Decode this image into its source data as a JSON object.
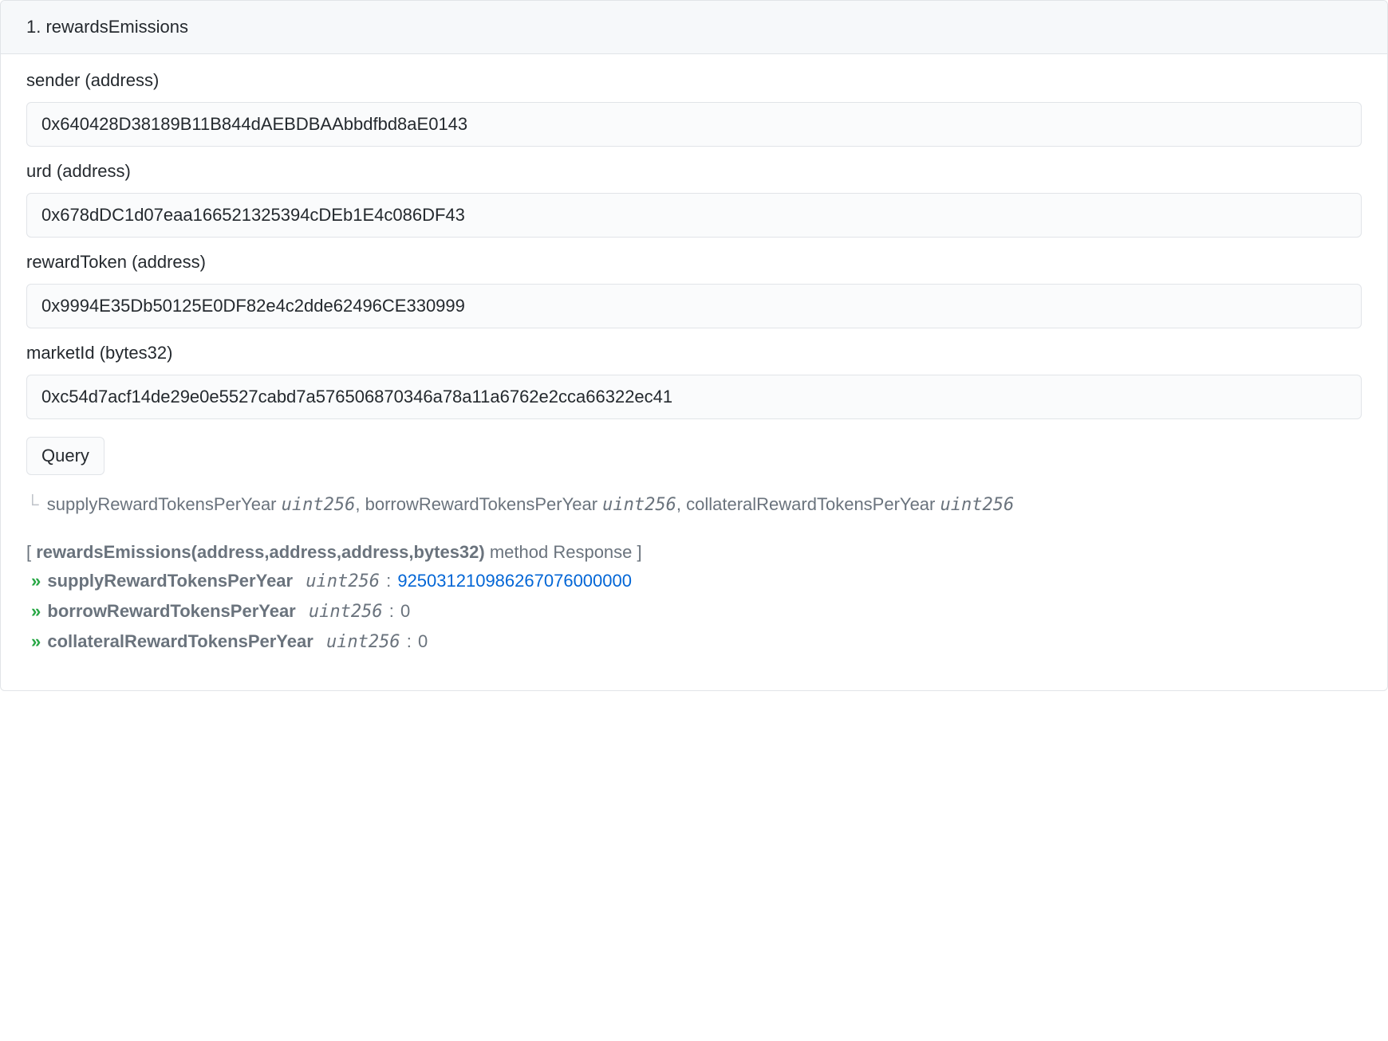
{
  "panel": {
    "header": "1. rewardsEmissions",
    "fields": [
      {
        "label": "sender (address)",
        "value": "0x640428D38189B11B844dAEBDBAAbbdfbd8aE0143"
      },
      {
        "label": "urd (address)",
        "value": "0x678dDC1d07eaa166521325394cDEb1E4c086DF43"
      },
      {
        "label": "rewardToken (address)",
        "value": "0x9994E35Db50125E0DF82e4c2dde62496CE330999"
      },
      {
        "label": "marketId (bytes32)",
        "value": "0xc54d7acf14de29e0e5527cabd7a576506870346a78a11a6762e2cca66322ec41"
      }
    ],
    "query_label": "Query",
    "return_sig": {
      "prefix_icon": "└",
      "parts": [
        {
          "name": "supplyRewardTokensPerYear",
          "type": "uint256",
          "sep": ", "
        },
        {
          "name": "borrowRewardTokensPerYear",
          "type": "uint256",
          "sep": ", "
        },
        {
          "name": "collateralRewardTokensPerYear",
          "type": "uint256",
          "sep": ""
        }
      ]
    },
    "response": {
      "bracket_open": "[ ",
      "method_sig": "rewardsEmissions(address,address,address,bytes32)",
      "method_suffix": " method Response ]",
      "rows": [
        {
          "name": "supplyRewardTokensPerYear",
          "type": "uint256",
          "value": "925031210986267076000000",
          "link": true
        },
        {
          "name": "borrowRewardTokensPerYear",
          "type": "uint256",
          "value": "0",
          "link": false
        },
        {
          "name": "collateralRewardTokensPerYear",
          "type": "uint256",
          "value": "0",
          "link": false
        }
      ]
    }
  }
}
